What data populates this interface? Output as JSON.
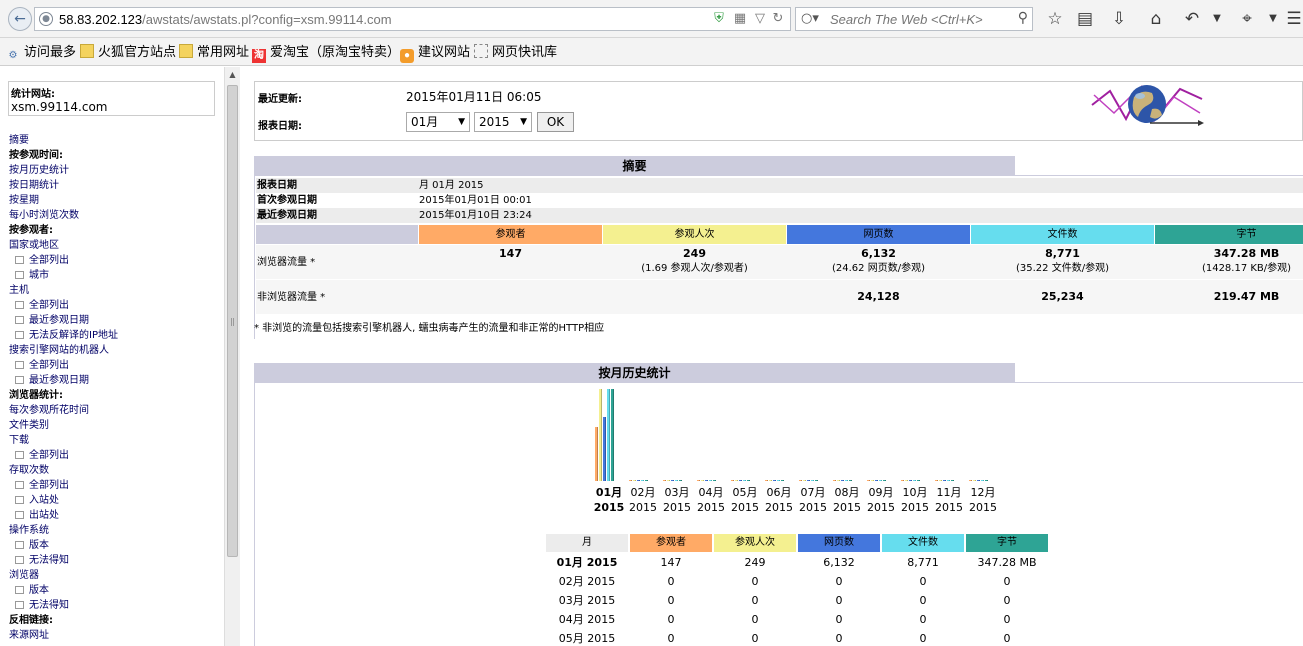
{
  "browser": {
    "url_host": "58.83.202.123",
    "url_path": "/awstats/awstats.pl?config=xsm.99114.com",
    "search_placeholder": "Search The Web <Ctrl+K>"
  },
  "bookmarks": [
    {
      "label": "访问最多",
      "icon": "gear-icon"
    },
    {
      "label": "火狐官方站点",
      "icon": "folder-icon"
    },
    {
      "label": "常用网址",
      "icon": "folder-icon"
    },
    {
      "label": "爱淘宝（原淘宝特卖）",
      "icon": "taobao-icon"
    },
    {
      "label": "建议网站",
      "icon": "bulb-icon"
    },
    {
      "label": "网页快讯库",
      "icon": "webslice-icon"
    }
  ],
  "sidebar": {
    "site_label": "统计网站:",
    "site_value": "xsm.99114.com",
    "menu": [
      {
        "label": "摘要",
        "type": "link"
      },
      {
        "label": "按参观时间:",
        "type": "header"
      },
      {
        "label": "按月历史统计",
        "type": "link"
      },
      {
        "label": "按日期统计",
        "type": "link"
      },
      {
        "label": "按星期",
        "type": "link"
      },
      {
        "label": "每小时浏览次数",
        "type": "link"
      },
      {
        "label": "按参观者:",
        "type": "header"
      },
      {
        "label": "国家或地区",
        "type": "link"
      },
      {
        "label": "全部列出",
        "type": "sub"
      },
      {
        "label": "城市",
        "type": "sub"
      },
      {
        "label": "主机",
        "type": "link"
      },
      {
        "label": "全部列出",
        "type": "sub"
      },
      {
        "label": "最近参观日期",
        "type": "sub"
      },
      {
        "label": "无法反解译的IP地址",
        "type": "sub"
      },
      {
        "label": "搜索引擎网站的机器人",
        "type": "link"
      },
      {
        "label": "全部列出",
        "type": "sub"
      },
      {
        "label": "最近参观日期",
        "type": "sub"
      },
      {
        "label": "浏览器统计:",
        "type": "header"
      },
      {
        "label": "每次参观所花时间",
        "type": "link"
      },
      {
        "label": "文件类别",
        "type": "link"
      },
      {
        "label": "下载",
        "type": "link"
      },
      {
        "label": "全部列出",
        "type": "sub"
      },
      {
        "label": "存取次数",
        "type": "link"
      },
      {
        "label": "全部列出",
        "type": "sub"
      },
      {
        "label": "入站处",
        "type": "sub"
      },
      {
        "label": "出站处",
        "type": "sub"
      },
      {
        "label": "操作系统",
        "type": "link"
      },
      {
        "label": "版本",
        "type": "sub"
      },
      {
        "label": "无法得知",
        "type": "sub"
      },
      {
        "label": "浏览器",
        "type": "link"
      },
      {
        "label": "版本",
        "type": "sub"
      },
      {
        "label": "无法得知",
        "type": "sub"
      },
      {
        "label": "反相链接:",
        "type": "header"
      },
      {
        "label": "来源网址",
        "type": "link"
      }
    ]
  },
  "header": {
    "last_update_label": "最近更新:",
    "last_update_value": "2015年01月11日 06:05",
    "report_date_label": "报表日期:",
    "month_select": "01月",
    "year_select": "2015",
    "ok_label": "OK"
  },
  "summary": {
    "title": "摘要",
    "report_date_label": "报表日期",
    "report_date_value": "月 01月 2015",
    "first_visit_label": "首次参观日期",
    "first_visit_value": "2015年01月01日 00:01",
    "last_visit_label": "最近参观日期",
    "last_visit_value": "2015年01月10日 23:24",
    "columns": [
      "参观者",
      "参观人次",
      "网页数",
      "文件数",
      "字节"
    ],
    "column_colors": [
      "#ffaa66",
      "#f4f090",
      "#4477dd",
      "#66ddee",
      "#2ea495"
    ],
    "browser_traffic_label": "浏览器流量 *",
    "browser_traffic": [
      "147",
      "249",
      "6,132",
      "8,771",
      "347.28 MB"
    ],
    "browser_traffic_sub": [
      "",
      "(1.69 参观人次/参观者)",
      "(24.62 网页数/参观)",
      "(35.22 文件数/参观)",
      "(1428.17 KB/参观)"
    ],
    "non_browser_label": "非浏览器流量 *",
    "non_browser": [
      "",
      "",
      "24,128",
      "25,234",
      "219.47 MB"
    ],
    "note": "* 非浏览的流量包括搜索引擎机器人, 蠕虫病毒产生的流量和非正常的HTTP相应"
  },
  "history": {
    "title": "按月历史统计",
    "months": [
      {
        "m": "01月",
        "y": "2015"
      },
      {
        "m": "02月",
        "y": "2015"
      },
      {
        "m": "03月",
        "y": "2015"
      },
      {
        "m": "04月",
        "y": "2015"
      },
      {
        "m": "05月",
        "y": "2015"
      },
      {
        "m": "06月",
        "y": "2015"
      },
      {
        "m": "07月",
        "y": "2015"
      },
      {
        "m": "08月",
        "y": "2015"
      },
      {
        "m": "09月",
        "y": "2015"
      },
      {
        "m": "10月",
        "y": "2015"
      },
      {
        "m": "11月",
        "y": "2015"
      },
      {
        "m": "12月",
        "y": "2015"
      }
    ],
    "chart_series_colors": [
      "#ffaa66",
      "#f4f090",
      "#4477dd",
      "#66ddee",
      "#2ea495"
    ],
    "table_headers": [
      "月",
      "参观者",
      "参观人次",
      "网页数",
      "文件数",
      "字节"
    ],
    "table_rows": [
      [
        "01月 2015",
        "147",
        "249",
        "6,132",
        "8,771",
        "347.28 MB"
      ],
      [
        "02月 2015",
        "0",
        "0",
        "0",
        "0",
        "0"
      ],
      [
        "03月 2015",
        "0",
        "0",
        "0",
        "0",
        "0"
      ],
      [
        "04月 2015",
        "0",
        "0",
        "0",
        "0",
        "0"
      ],
      [
        "05月 2015",
        "0",
        "0",
        "0",
        "0",
        "0"
      ]
    ]
  },
  "chart_data": {
    "type": "bar",
    "categories": [
      "01月 2015",
      "02月 2015",
      "03月 2015",
      "04月 2015",
      "05月 2015",
      "06月 2015",
      "07月 2015",
      "08月 2015",
      "09月 2015",
      "10月 2015",
      "11月 2015",
      "12月 2015"
    ],
    "series": [
      {
        "name": "参观者",
        "values": [
          147,
          0,
          0,
          0,
          0,
          0,
          0,
          0,
          0,
          0,
          0,
          0
        ]
      },
      {
        "name": "参观人次",
        "values": [
          249,
          0,
          0,
          0,
          0,
          0,
          0,
          0,
          0,
          0,
          0,
          0
        ]
      },
      {
        "name": "网页数",
        "values": [
          6132,
          0,
          0,
          0,
          0,
          0,
          0,
          0,
          0,
          0,
          0,
          0
        ]
      },
      {
        "name": "文件数",
        "values": [
          8771,
          0,
          0,
          0,
          0,
          0,
          0,
          0,
          0,
          0,
          0,
          0
        ]
      },
      {
        "name": "字节",
        "values": [
          347.28,
          0,
          0,
          0,
          0,
          0,
          0,
          0,
          0,
          0,
          0,
          0
        ]
      }
    ]
  }
}
